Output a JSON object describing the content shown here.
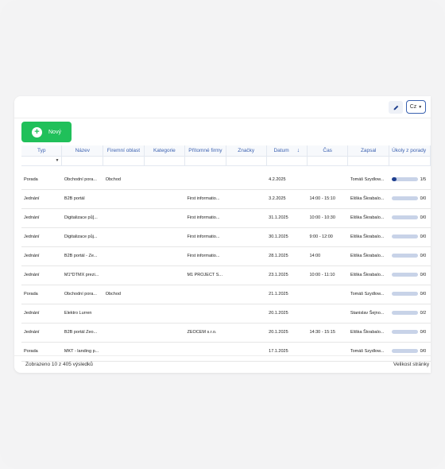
{
  "toolbar": {
    "edit_icon": "pencil-icon",
    "language": "Cz",
    "new_label": "Nový"
  },
  "columns": [
    "Typ",
    "Název",
    "Firemní oblast",
    "Kategorie",
    "Přítomné firmy",
    "Značky",
    "Datum",
    "Čas",
    "Zapsal",
    "Úkoly z porady"
  ],
  "sort_indicator": "↓",
  "rows": [
    {
      "typ": "Porada",
      "nazev": "Obchodní pora...",
      "oblast": "Obchod",
      "kategorie": "",
      "firmy": "",
      "znacky": "",
      "datum": "4.2.2025",
      "cas": "",
      "zapsal": "Tomáš Szydlow...",
      "progress": 0.2,
      "ukoly": "1/5"
    },
    {
      "typ": "Jednání",
      "nazev": "B2B portál",
      "oblast": "",
      "kategorie": "",
      "firmy": "First informatio...",
      "znacky": "",
      "datum": "3.2.2025",
      "cas": "14:00 - 15:10",
      "zapsal": "Eliška Škrabalo...",
      "progress": 0,
      "ukoly": "0/0"
    },
    {
      "typ": "Jednání",
      "nazev": "Digitalizace pů]...",
      "oblast": "",
      "kategorie": "",
      "firmy": "First informatio...",
      "znacky": "",
      "datum": "31.1.2025",
      "cas": "10:00 - 10:30",
      "zapsal": "Eliška Škrabalo...",
      "progress": 0,
      "ukoly": "0/0"
    },
    {
      "typ": "Jednání",
      "nazev": "Digitalizace půj...",
      "oblast": "",
      "kategorie": "",
      "firmy": "First informatio...",
      "znacky": "",
      "datum": "30.1.2025",
      "cas": "9:00 - 12:00",
      "zapsal": "Eliška Škrabalo...",
      "progress": 0,
      "ukoly": "0/0"
    },
    {
      "typ": "Jednání",
      "nazev": "B2B portál - Ze...",
      "oblast": "",
      "kategorie": "",
      "firmy": "First informatio...",
      "znacky": "",
      "datum": "28.1.2025",
      "cas": "14:00",
      "zapsal": "Eliška Škrabalo...",
      "progress": 0,
      "ukoly": "0/0"
    },
    {
      "typ": "Jednání",
      "nazev": "M1*DTMX prezi...",
      "oblast": "",
      "kategorie": "",
      "firmy": "M1 PROJECT S...",
      "znacky": "",
      "datum": "23.1.2025",
      "cas": "10:00 - 11:10",
      "zapsal": "Eliška Škrabalo...",
      "progress": 0,
      "ukoly": "0/0"
    },
    {
      "typ": "Porada",
      "nazev": "Obchodní pora...",
      "oblast": "Obchod",
      "kategorie": "",
      "firmy": "",
      "znacky": "",
      "datum": "21.1.2025",
      "cas": "",
      "zapsal": "Tomáš Szydlow...",
      "progress": 0,
      "ukoly": "0/0"
    },
    {
      "typ": "Jednání",
      "nazev": "Elektro Lurren",
      "oblast": "",
      "kategorie": "",
      "firmy": "",
      "znacky": "",
      "datum": "20.1.2025",
      "cas": "",
      "zapsal": "Stanislav Šejno...",
      "progress": 0,
      "ukoly": "0/2"
    },
    {
      "typ": "Jednání",
      "nazev": "B2B portál Zeo...",
      "oblast": "",
      "kategorie": "",
      "firmy": "ZEOCEM s.r.o.",
      "znacky": "",
      "datum": "20.1.2025",
      "cas": "14:30 - 15:15",
      "zapsal": "Eliška Škrabalo...",
      "progress": 0,
      "ukoly": "0/0"
    },
    {
      "typ": "Porada",
      "nazev": "MKT - landing p...",
      "oblast": "",
      "kategorie": "",
      "firmy": "",
      "znacky": "",
      "datum": "17.1.2025",
      "cas": "",
      "zapsal": "Tomáš Szydlow...",
      "progress": 0,
      "ukoly": "0/0"
    }
  ],
  "footer": {
    "results": "Zobrazeno 10 z 405 výsledků",
    "page_size_label": "Velikost stránky"
  },
  "colors": {
    "accent": "#3d62b1",
    "new_button": "#20c05a",
    "progress_fill": "#1f3f8f",
    "progress_track": "#c8d3e8"
  }
}
